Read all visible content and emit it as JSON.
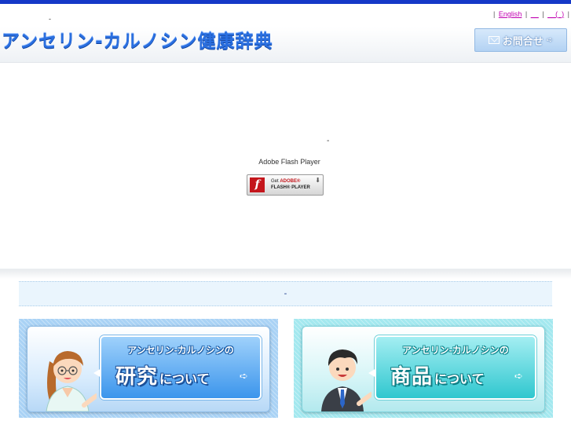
{
  "header": {
    "small_dash": "-",
    "logo_text": "アンセリン-カルノシン健康辞典",
    "links": [
      {
        "label": "English"
      },
      {
        "label": "__"
      },
      {
        "label": "__(_)"
      }
    ],
    "separator": "|",
    "contact_label": "お問合せ"
  },
  "flash": {
    "dash": "-",
    "message": "Adobe Flash Player",
    "badge_line1_prefix": "Get ",
    "badge_line1_brand": "ADOBE®",
    "badge_line2": "FLASH® PLAYER",
    "badge_logo": "f"
  },
  "info_bar": {
    "text": "-"
  },
  "banners": [
    {
      "top": "アンセリン-カルノシンの",
      "big": "研究",
      "small": "について"
    },
    {
      "top": "アンセリン-カルノシンの",
      "big": "商品",
      "small": "について"
    }
  ],
  "colors": {
    "top_bar": "#1538c8",
    "logo": "#2a6fe0",
    "link": "#c000b0",
    "research_banner": "#a9d2f5",
    "products_banner": "#a3e8ef"
  }
}
